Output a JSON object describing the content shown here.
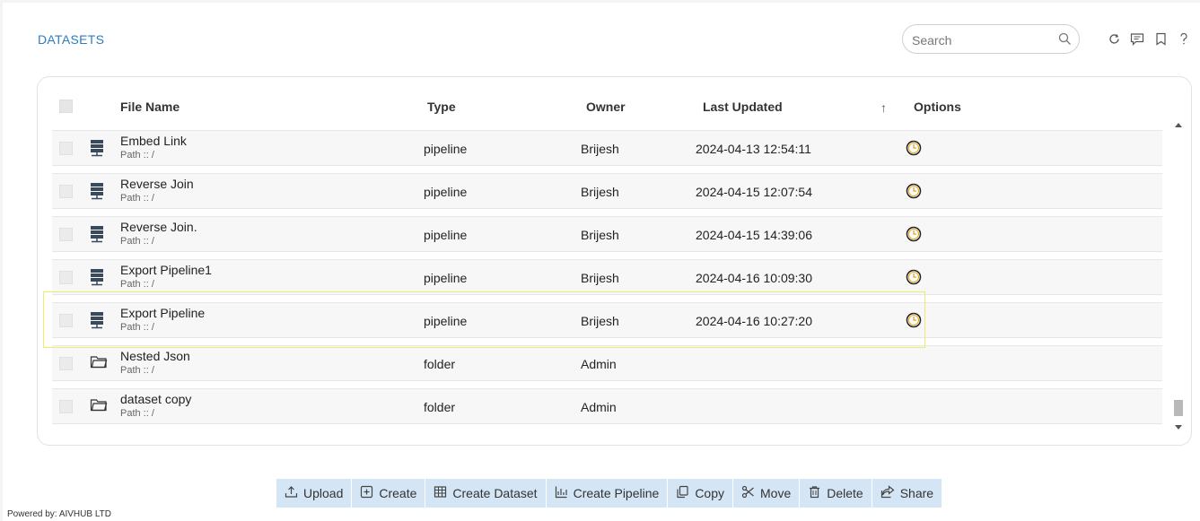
{
  "header": {
    "title": "DATASETS",
    "search_placeholder": "Search"
  },
  "table": {
    "columns": {
      "file_name": "File Name",
      "type": "Type",
      "owner": "Owner",
      "last_updated": "Last Updated",
      "options": "Options"
    },
    "sort_indicator": "↑",
    "rows": [
      {
        "name": "Embed Link",
        "path": "Path :: /",
        "type": "pipeline",
        "owner": "Brijesh",
        "updated": "2024-04-13 12:54:11",
        "icon": "pipeline-icon"
      },
      {
        "name": "Reverse Join",
        "path": "Path :: /",
        "type": "pipeline",
        "owner": "Brijesh",
        "updated": "2024-04-15 12:07:54",
        "icon": "pipeline-icon"
      },
      {
        "name": "Reverse Join.",
        "path": "Path :: /",
        "type": "pipeline",
        "owner": "Brijesh",
        "updated": "2024-04-15 14:39:06",
        "icon": "pipeline-icon"
      },
      {
        "name": "Export Pipeline1",
        "path": "Path :: /",
        "type": "pipeline",
        "owner": "Brijesh",
        "updated": "2024-04-16 10:09:30",
        "icon": "pipeline-icon"
      },
      {
        "name": "Export Pipeline",
        "path": "Path :: /",
        "type": "pipeline",
        "owner": "Brijesh",
        "updated": "2024-04-16 10:27:20",
        "icon": "pipeline-icon"
      },
      {
        "name": "Nested Json",
        "path": "Path :: /",
        "type": "folder",
        "owner": "Admin",
        "updated": "",
        "icon": "folder-icon"
      },
      {
        "name": "dataset copy",
        "path": "Path :: /",
        "type": "folder",
        "owner": "Admin",
        "updated": "",
        "icon": "folder-icon"
      }
    ]
  },
  "toolbar": {
    "upload": "Upload",
    "create": "Create",
    "create_dataset": "Create Dataset",
    "create_pipeline": "Create Pipeline",
    "copy": "Copy",
    "move": "Move",
    "delete": "Delete",
    "share": "Share"
  },
  "footer": {
    "powered_by": "Powered by: AIVHUB LTD"
  },
  "colors": {
    "accent": "#2f7ac0",
    "toolbar_bg": "#d4e6f6",
    "schedule_icon": "#e8a21a",
    "highlight_border": "#ecec6a"
  }
}
